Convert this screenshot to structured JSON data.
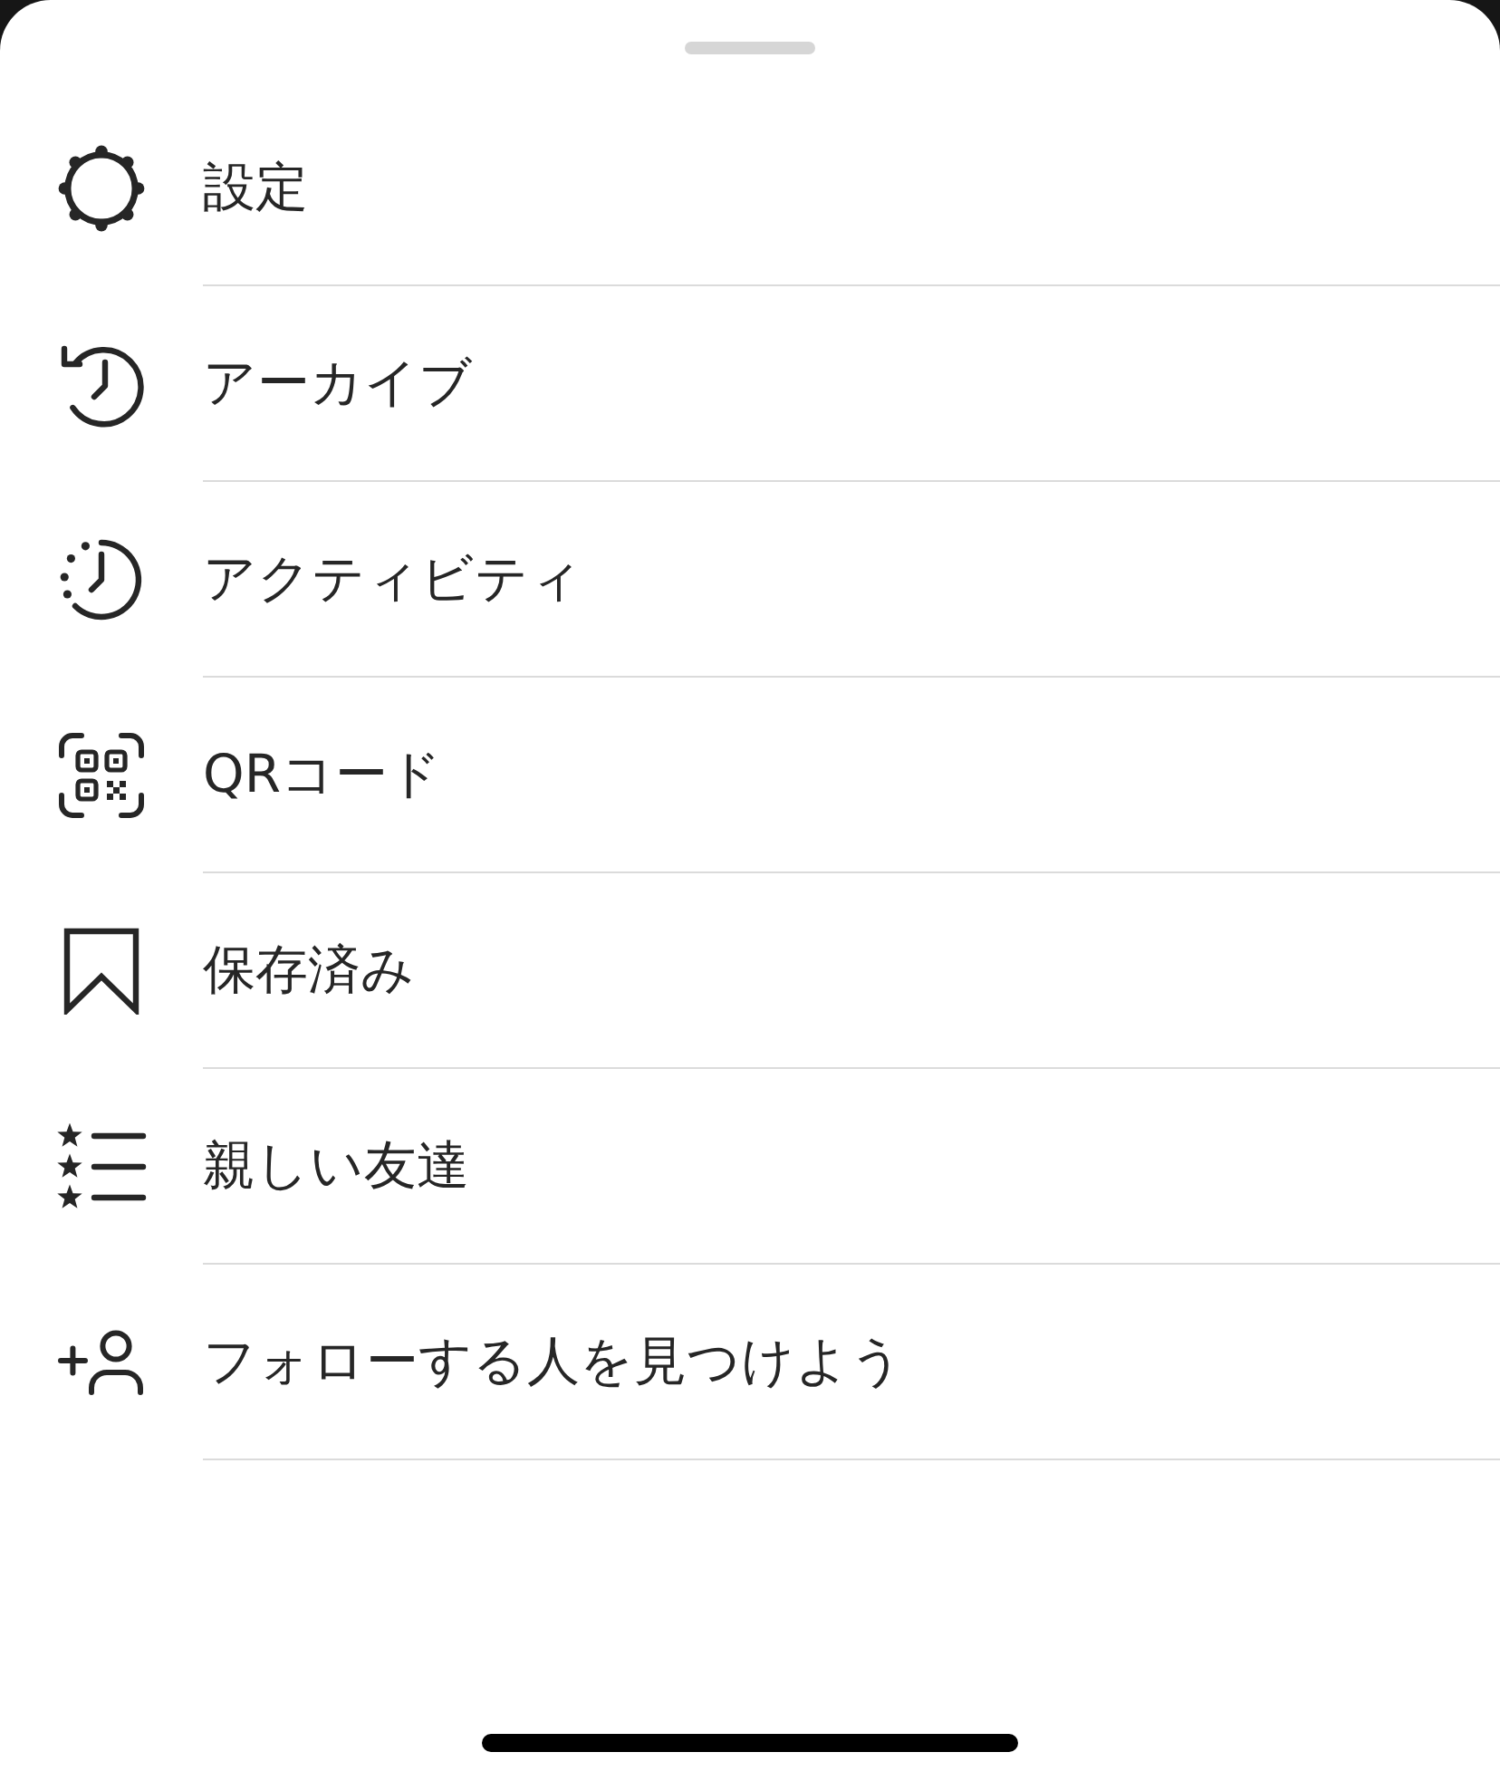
{
  "menu": {
    "items": [
      {
        "kind": "settings",
        "label": "設定"
      },
      {
        "kind": "archive",
        "label": "アーカイブ"
      },
      {
        "kind": "activity",
        "label": "アクティビティ"
      },
      {
        "kind": "qr_code",
        "label": "QRコード"
      },
      {
        "kind": "saved",
        "label": "保存済み"
      },
      {
        "kind": "close_friends",
        "label": "親しい友達"
      },
      {
        "kind": "discover_people",
        "label": "フォローする人を見つけよう"
      }
    ]
  }
}
